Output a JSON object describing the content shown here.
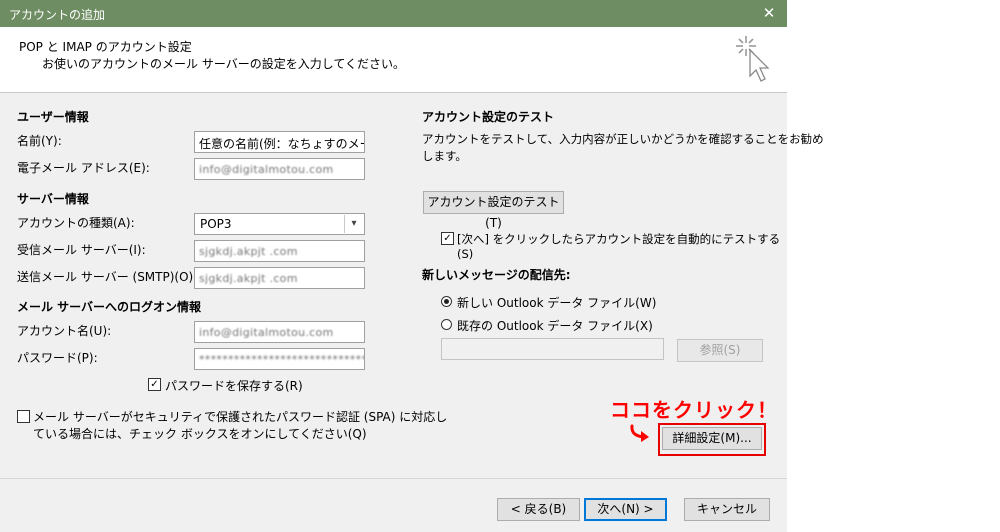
{
  "window": {
    "title": "アカウントの追加",
    "close_glyph": "✕"
  },
  "header": {
    "title": "POP と IMAP のアカウント設定",
    "subtitle": "お使いのアカウントのメール サーバーの設定を入力してください。",
    "icon": "wizard-cursor-icon"
  },
  "user_info": {
    "section": "ユーザー情報",
    "name_label": "名前(Y):",
    "name_value": "任意の名前(例：なちょすのメール)",
    "email_label": "電子メール アドレス(E):",
    "email_value": "info@digitalmotou.com"
  },
  "server_info": {
    "section": "サーバー情報",
    "type_label": "アカウントの種類(A):",
    "type_value": "POP3",
    "incoming_label": "受信メール サーバー(I):",
    "incoming_value": "sjgkdj.akpjt .com",
    "outgoing_label": "送信メール サーバー (SMTP)(O):",
    "outgoing_value": "sjgkdj.akpjt .com"
  },
  "logon_info": {
    "section": "メール サーバーへのログオン情報",
    "account_label": "アカウント名(U):",
    "account_value": "info@digitalmotou.com",
    "password_label": "パスワード(P):",
    "password_value": "********************************",
    "save_password_label": "パスワードを保存する(R)",
    "save_password_checked": true,
    "spa_label_line1": "メール サーバーがセキュリティで保護されたパスワード認証 (SPA) に対応し",
    "spa_label_line2": "ている場合には、チェック ボックスをオンにしてください(Q)",
    "spa_checked": false
  },
  "test": {
    "section": "アカウント設定のテスト",
    "desc_line1": "アカウントをテストして、入力内容が正しいかどうかを確認することをお勧め",
    "desc_line2": "します。",
    "button": "アカウント設定のテスト(T)",
    "auto_test_line1": "[次へ] をクリックしたらアカウント設定を自動的にテストする",
    "auto_test_line2": "(S)",
    "auto_test_checked": true
  },
  "delivery": {
    "section": "新しいメッセージの配信先:",
    "new_file_label": "新しい Outlook データ ファイル(W)",
    "existing_file_label": "既存の Outlook データ ファイル(X)",
    "selected": "new",
    "browse_button": "参照(S)"
  },
  "advanced": {
    "button": "詳細設定(M)...",
    "annotation": "ココをクリック！",
    "highlight_color": "#e60000"
  },
  "footer": {
    "back": "< 戻る(B)",
    "next": "次へ(N) >",
    "cancel": "キャンセル"
  },
  "colors": {
    "titlebar": "#6e8d63",
    "dialog_bg": "#f0f0f0",
    "annotation": "#ff0000"
  }
}
